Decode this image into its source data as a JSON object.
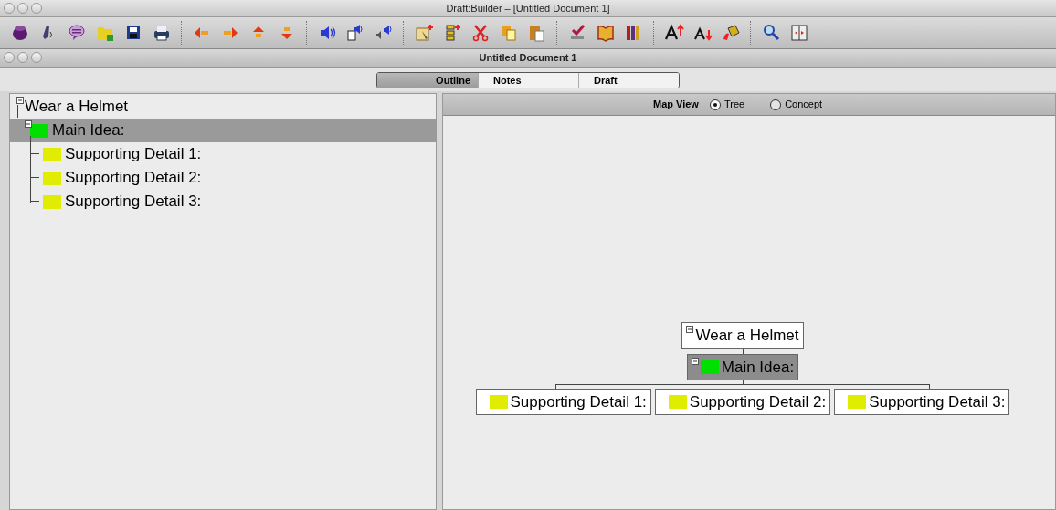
{
  "app_window": {
    "title": "Draft:Builder – [Untitled Document 1]"
  },
  "document_window": {
    "title": "Untitled Document 1"
  },
  "tabs": [
    {
      "label": "Outline",
      "selected": true
    },
    {
      "label": "Notes",
      "selected": false
    },
    {
      "label": "Draft",
      "selected": false
    }
  ],
  "outline": {
    "items": [
      {
        "label": "Wear a Helmet",
        "expanded": true,
        "selected": false,
        "children": [
          {
            "label": "Main Idea:",
            "color": "#00e000",
            "expanded": true,
            "selected": true,
            "children": [
              {
                "label": "Supporting Detail 1:",
                "color": "#e0ec00",
                "selected": false
              },
              {
                "label": "Supporting Detail 2:",
                "color": "#e0ec00",
                "selected": false
              },
              {
                "label": "Supporting Detail 3:",
                "color": "#e0ec00",
                "selected": false
              }
            ]
          }
        ]
      }
    ]
  },
  "map_view": {
    "label": "Map View",
    "options": [
      {
        "label": "Tree",
        "selected": true
      },
      {
        "label": "Concept",
        "selected": false
      }
    ],
    "root": {
      "label": "Wear a Helmet",
      "expanded": true,
      "selected": false,
      "children": [
        {
          "label": "Main Idea:",
          "color": "#00e000",
          "expanded": true,
          "selected": true,
          "children": [
            {
              "label": "Supporting Detail 1:",
              "color": "#e0ec00",
              "selected": false
            },
            {
              "label": "Supporting Detail 2:",
              "color": "#e0ec00",
              "selected": false
            },
            {
              "label": "Supporting Detail 3:",
              "color": "#e0ec00",
              "selected": false
            }
          ]
        }
      ]
    }
  }
}
